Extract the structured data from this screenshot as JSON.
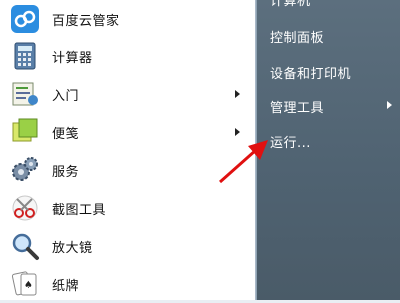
{
  "programs": [
    {
      "label": "百度云管家",
      "icon": "cloud-icon",
      "submenu": false
    },
    {
      "label": "计算器",
      "icon": "calculator-icon",
      "submenu": false
    },
    {
      "label": "入门",
      "icon": "getting-started-icon",
      "submenu": true
    },
    {
      "label": "便笺",
      "icon": "sticky-notes-icon",
      "submenu": true
    },
    {
      "label": "服务",
      "icon": "services-gear-icon",
      "submenu": false
    },
    {
      "label": "截图工具",
      "icon": "snipping-tool-icon",
      "submenu": false
    },
    {
      "label": "放大镜",
      "icon": "magnifier-icon",
      "submenu": false
    },
    {
      "label": "纸牌",
      "icon": "solitaire-cards-icon",
      "submenu": false
    }
  ],
  "right_pane": {
    "top_partial": "计算机",
    "control_panel": "控制面板",
    "devices_printers": "设备和打印机",
    "admin_tools": "管理工具",
    "run": "运行..."
  },
  "colors": {
    "right_pane": "#53667a",
    "annotation_arrow": "#e01010"
  }
}
